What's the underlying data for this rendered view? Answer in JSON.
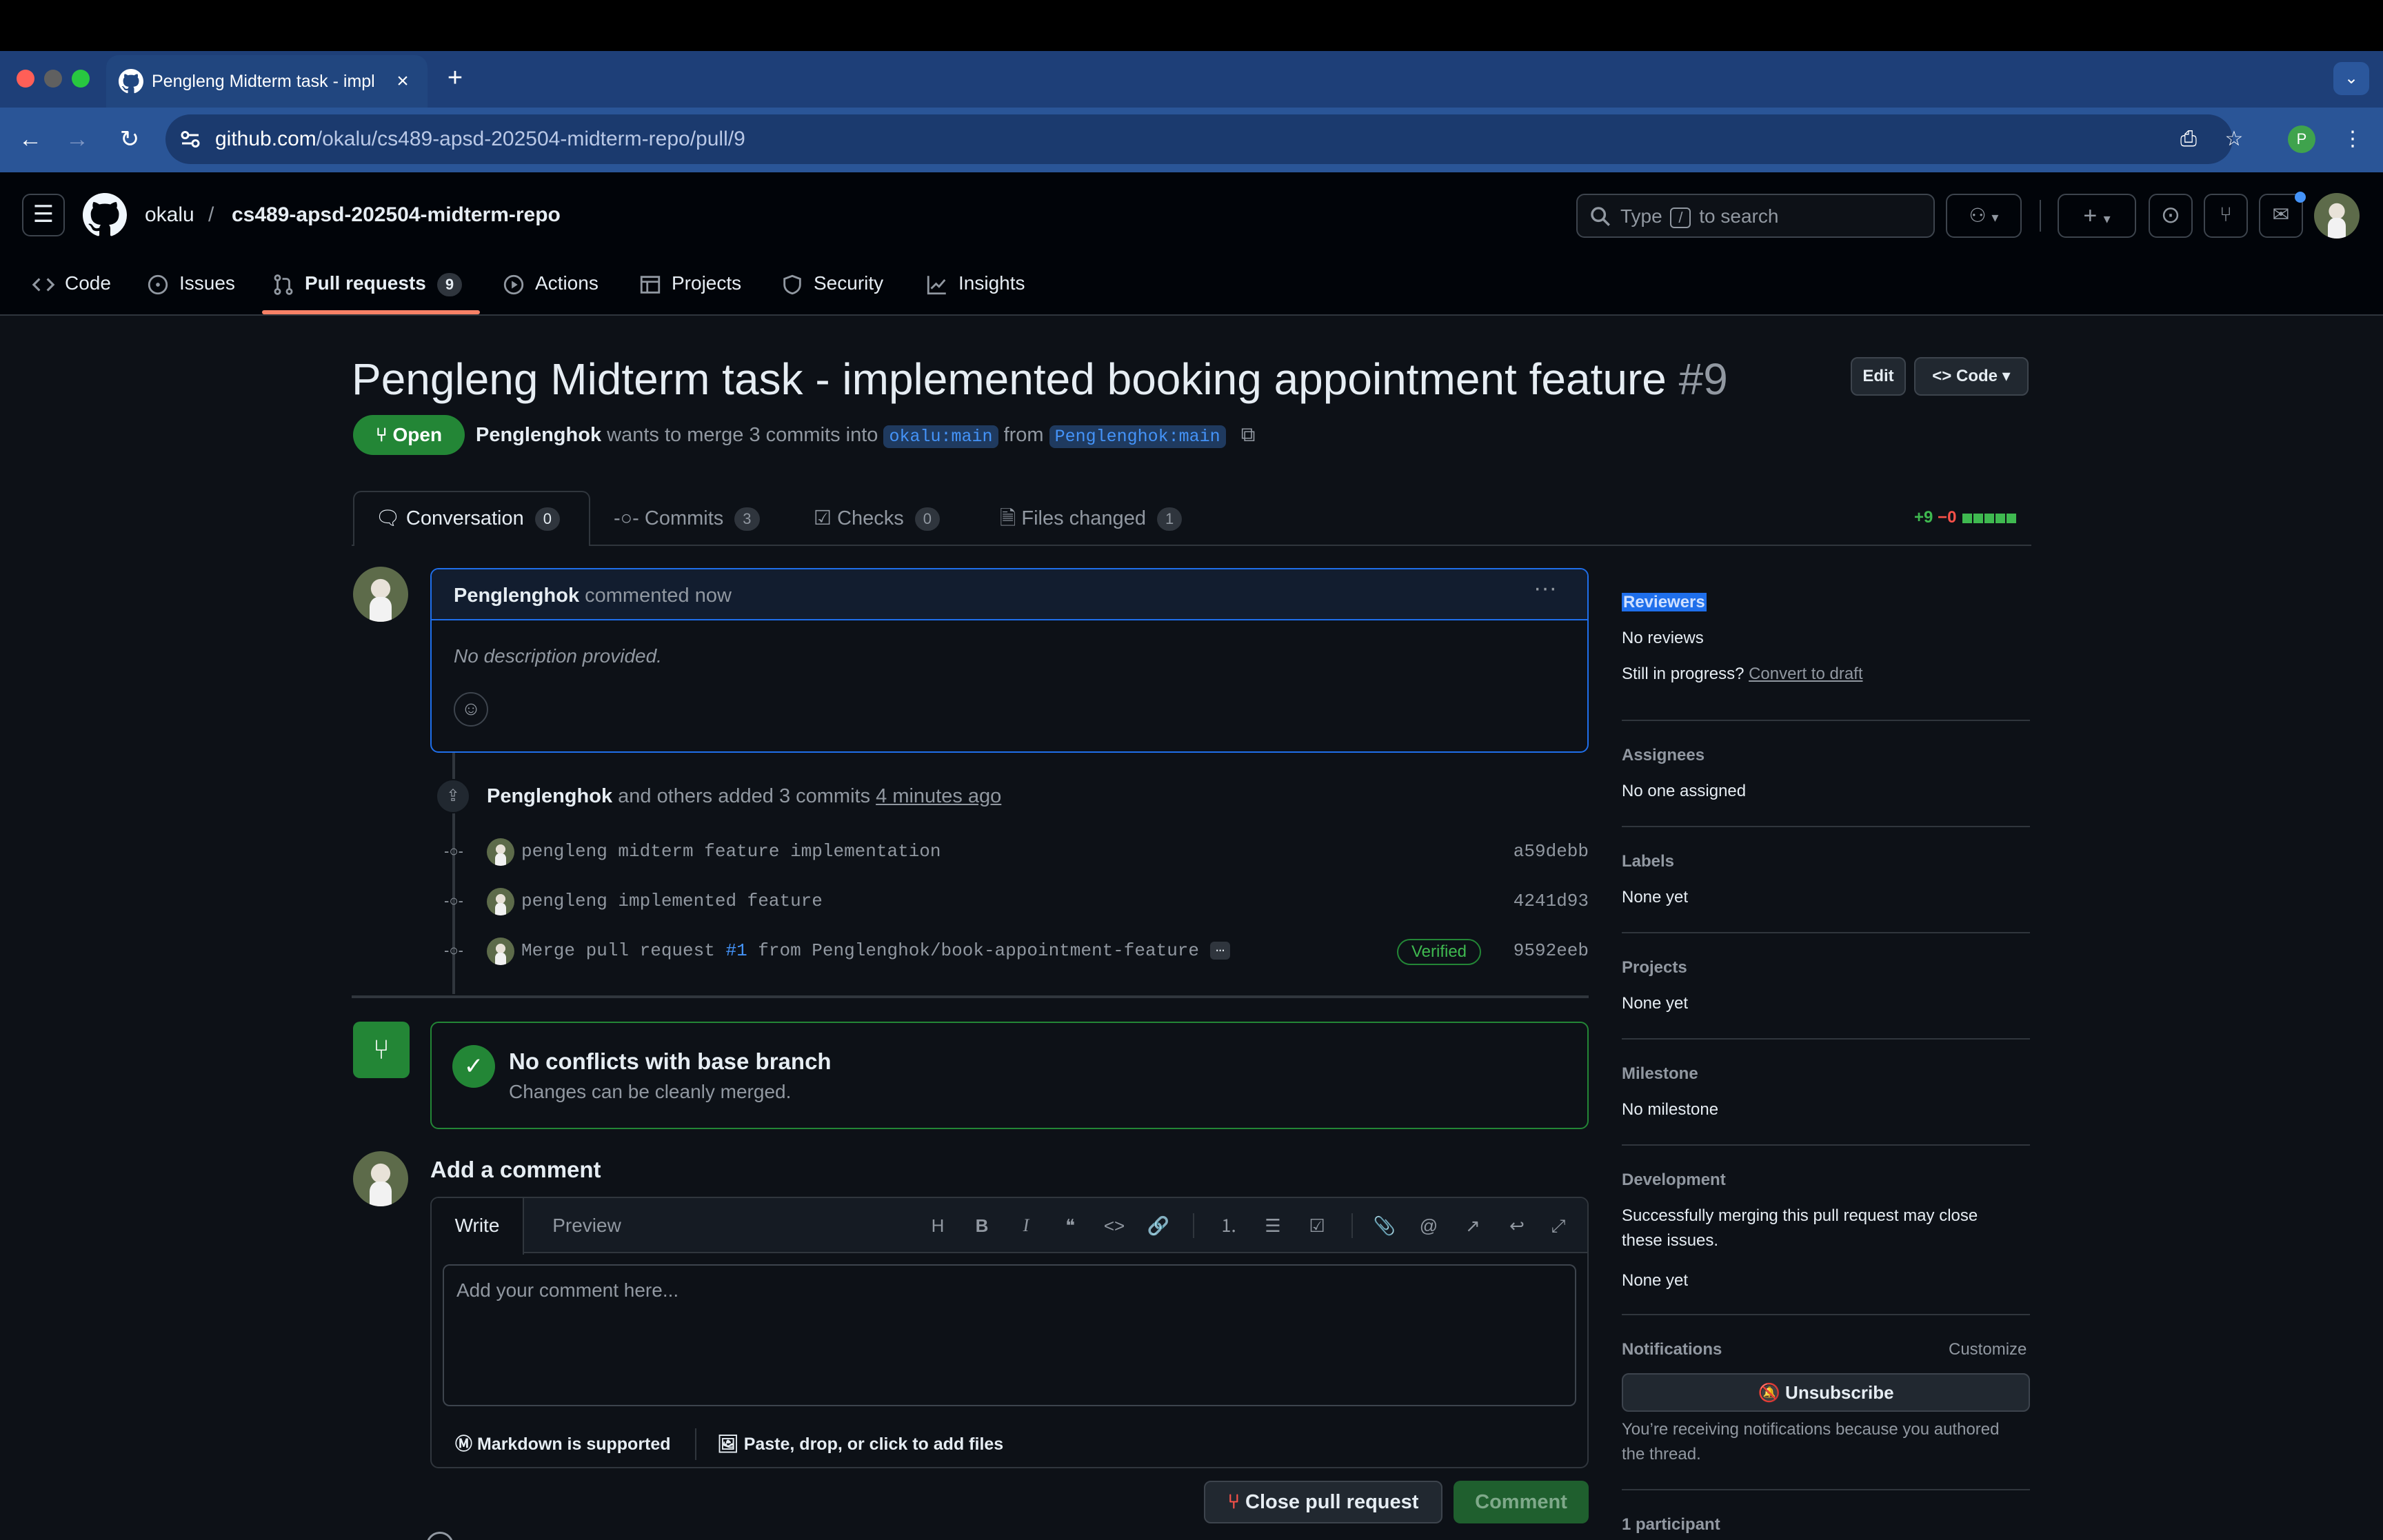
{
  "browser": {
    "tab_title": "Pengleng Midterm task - impl",
    "tab_close": "×",
    "new_tab": "+",
    "url_host": "github.com",
    "url_path": "/okalu/cs489-apsd-202504-midterm-repo/pull/9",
    "profile_initial": "P",
    "traffic_colors": [
      "#ff5f57",
      "#606060",
      "#28c840"
    ]
  },
  "header": {
    "owner": "okalu",
    "separator": "/",
    "repo": "cs489-apsd-202504-midterm-repo",
    "search_prefix": "Type",
    "search_key": "/",
    "search_suffix": "to search"
  },
  "repo_nav": {
    "tabs": [
      {
        "label": "Code",
        "icon": "code-icon"
      },
      {
        "label": "Issues",
        "icon": "issue-icon"
      },
      {
        "label": "Pull requests",
        "icon": "pull-request-icon",
        "count": "9",
        "active": true
      },
      {
        "label": "Actions",
        "icon": "play-icon"
      },
      {
        "label": "Projects",
        "icon": "table-icon"
      },
      {
        "label": "Security",
        "icon": "shield-icon"
      },
      {
        "label": "Insights",
        "icon": "graph-icon"
      }
    ]
  },
  "pr": {
    "title": "Pengleng Midterm task - implemented booking appointment feature",
    "number": "#9",
    "edit_label": "Edit",
    "code_label": "Code",
    "state": "Open",
    "author": "Penglenghok",
    "meta_middle": "wants to merge 3 commits into",
    "base_branch": "okalu:main",
    "meta_from": "from",
    "head_branch": "Penglenghok:main"
  },
  "pr_tabs": [
    {
      "label": "Conversation",
      "count": "0"
    },
    {
      "label": "Commits",
      "count": "3"
    },
    {
      "label": "Checks",
      "count": "0"
    },
    {
      "label": "Files changed",
      "count": "1"
    }
  ],
  "diffstat": {
    "additions": "+9",
    "deletions": "−0",
    "add_color": "#3fb950",
    "del_color": "#f85149"
  },
  "comment": {
    "author": "Penglenghok",
    "action": "commented now",
    "body": "No description provided."
  },
  "commits_summary": {
    "author": "Penglenghok",
    "middle": "and others added 3 commits",
    "time": "4 minutes ago"
  },
  "commits": [
    {
      "message": "pengleng midterm feature implementation",
      "sha": "a59debb"
    },
    {
      "message": "pengleng implemented feature",
      "sha": "4241d93"
    },
    {
      "message_prefix": "Merge pull request",
      "message_link": "#1",
      "message_suffix": "from Penglenghok/book-appointment-feature",
      "more": "…",
      "verified": "Verified",
      "sha": "9592eeb"
    }
  ],
  "merge": {
    "title": "No conflicts with base branch",
    "subtitle": "Changes can be cleanly merged."
  },
  "add_comment": {
    "title": "Add a comment",
    "write_tab": "Write",
    "preview_tab": "Preview",
    "placeholder": "Add your comment here...",
    "markdown_note": "Markdown is supported",
    "attach_note": "Paste, drop, or click to add files",
    "close_label": "Close pull request",
    "comment_label": "Comment"
  },
  "sidebar": {
    "reviewers_heading": "Reviewers",
    "reviewers_value": "No reviews",
    "in_progress": "Still in progress?",
    "convert_draft": "Convert to draft",
    "assignees_heading": "Assignees",
    "assignees_value": "No one assigned",
    "labels_heading": "Labels",
    "labels_value": "None yet",
    "projects_heading": "Projects",
    "projects_value": "None yet",
    "milestone_heading": "Milestone",
    "milestone_value": "No milestone",
    "development_heading": "Development",
    "development_line1": "Successfully merging this pull request may close",
    "development_line2": "these issues.",
    "development_value": "None yet",
    "notifications_heading": "Notifications",
    "customize": "Customize",
    "unsubscribe": "Unsubscribe",
    "notif_line1": "You’re receiving notifications because you authored",
    "notif_line2": "the thread.",
    "participants": "1 participant"
  }
}
